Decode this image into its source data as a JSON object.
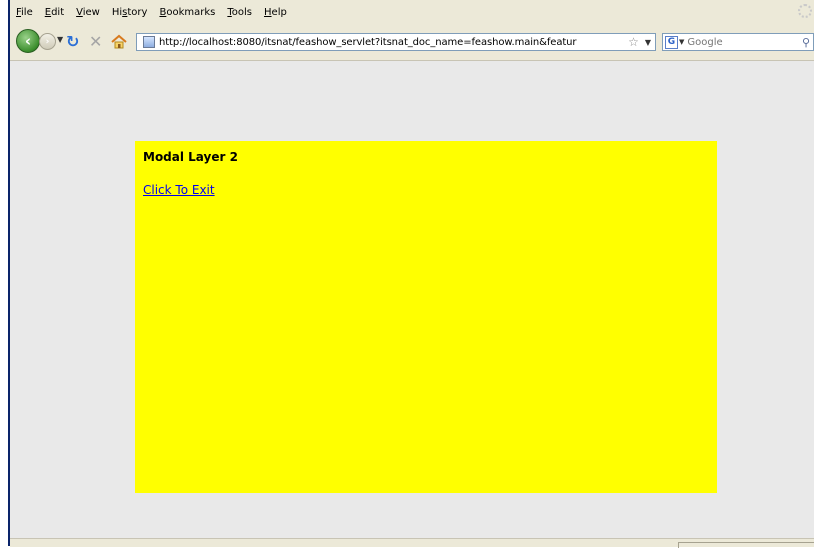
{
  "menu": {
    "items": [
      {
        "acc": "F",
        "rest": "ile"
      },
      {
        "acc": "E",
        "rest": "dit"
      },
      {
        "acc": "V",
        "rest": "iew"
      },
      {
        "pre": "Hi",
        "acc": "s",
        "rest": "tory"
      },
      {
        "acc": "B",
        "rest": "ookmarks"
      },
      {
        "acc": "T",
        "rest": "ools"
      },
      {
        "acc": "H",
        "rest": "elp"
      }
    ]
  },
  "nav": {
    "back_icon": "back-arrow-icon",
    "forward_icon": "forward-arrow-icon",
    "reload_icon": "reload-icon",
    "stop_icon": "stop-icon",
    "home_icon": "home-icon",
    "url": "http://localhost:8080/itsnat/feashow_servlet?itsnat_doc_name=feashow.main&featur",
    "search_placeholder": "Google"
  },
  "page": {
    "background": "#e9e9e9",
    "modal": {
      "background": "#ffff00",
      "title": "Modal Layer 2",
      "link": "Click To Exit"
    }
  }
}
